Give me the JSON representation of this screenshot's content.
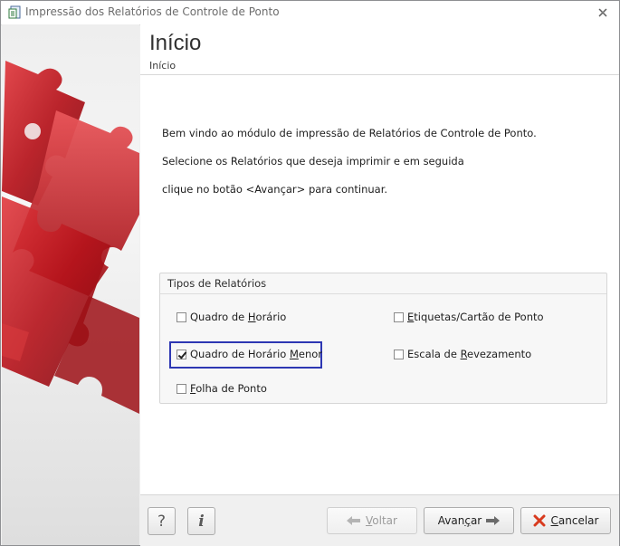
{
  "window": {
    "title": "Impressão dos Relatórios de Controle de Ponto",
    "icon": "report-icon",
    "close_icon": "close-icon"
  },
  "header": {
    "title": "Início",
    "subtitle": "Início"
  },
  "intro": {
    "line1": "Bem vindo ao módulo de impressão de Relatórios de Controle de Ponto.",
    "line2": "Selecione os Relatórios que deseja imprimir e em seguida",
    "line3": "clique no botão <Avançar> para continuar."
  },
  "report_types": {
    "group_title": "Tipos de Relatórios",
    "options": [
      {
        "pre": "Quadro de ",
        "key": "H",
        "post": "orário",
        "checked": false
      },
      {
        "pre": "Quadro de Horário ",
        "key": "M",
        "post": "enor",
        "checked": true
      },
      {
        "pre": "",
        "key": "F",
        "post": "olha de Ponto",
        "checked": false
      },
      {
        "pre": "",
        "key": "E",
        "post": "tiquetas/Cartão de Ponto",
        "checked": false
      },
      {
        "pre": "Escala de ",
        "key": "R",
        "post": "evezamento",
        "checked": false
      }
    ]
  },
  "footer": {
    "help_label": "?",
    "info_label": "i",
    "back": {
      "pre": "",
      "key": "V",
      "post": "oltar",
      "enabled": false,
      "icon": "arrow-left-icon"
    },
    "next": {
      "pre": "Avan",
      "key": "ç",
      "post": "ar",
      "enabled": true,
      "icon": "arrow-right-icon"
    },
    "cancel": {
      "pre": "",
      "key": "C",
      "post": "ancelar",
      "enabled": true,
      "icon": "cancel-x-icon"
    }
  },
  "colors": {
    "focus_ring": "#2d37b3",
    "puzzle_red": "#c0141b",
    "cancel_icon": "#d83a1e",
    "arrow_green": "#3a8a3a"
  }
}
